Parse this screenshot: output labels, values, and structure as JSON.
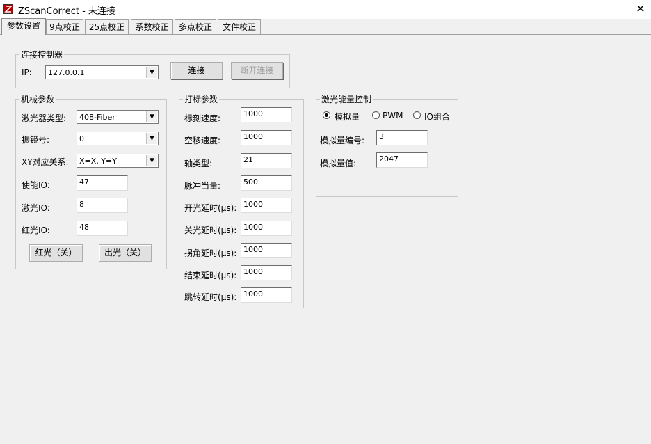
{
  "window": {
    "title": "ZScanCorrect - 未连接",
    "close_icon": "close-icon"
  },
  "tabs": [
    {
      "label": "参数设置"
    },
    {
      "label": "9点校正"
    },
    {
      "label": "25点校正"
    },
    {
      "label": "系数校正"
    },
    {
      "label": "多点校正"
    },
    {
      "label": "文件校正"
    }
  ],
  "connect": {
    "group_label": "连接控制器",
    "ip_label": "IP:",
    "ip_value": "127.0.0.1",
    "connect_button": "连接",
    "disconnect_button": "断开连接"
  },
  "mechanical": {
    "group_label": "机械参数",
    "laser_type_label": "激光器类型:",
    "laser_type_value": "408-Fiber",
    "galvo_label": "振镜号:",
    "galvo_value": "0",
    "xy_label": "XY对应关系:",
    "xy_value": "X=X, Y=Y",
    "enable_io_label": "使能IO:",
    "enable_io_value": "47",
    "laser_io_label": "激光IO:",
    "laser_io_value": "8",
    "red_io_label": "红光IO:",
    "red_io_value": "48",
    "red_light_button": "红光（关）",
    "laser_out_button": "出光（关）"
  },
  "marking": {
    "group_label": "打标参数",
    "fields": [
      {
        "label": "标刻速度:",
        "value": "1000"
      },
      {
        "label": "空移速度:",
        "value": "1000"
      },
      {
        "label": "轴类型:",
        "value": "21"
      },
      {
        "label": "脉冲当量:",
        "value": "500"
      },
      {
        "label": "开光延时(μs):",
        "value": "1000"
      },
      {
        "label": "关光延时(μs):",
        "value": "1000"
      },
      {
        "label": "拐角延时(μs):",
        "value": "1000"
      },
      {
        "label": "结束延时(μs):",
        "value": "1000"
      },
      {
        "label": "跳转延时(μs):",
        "value": "1000"
      }
    ]
  },
  "energy": {
    "group_label": "激光能量控制",
    "radio_analog": "模拟量",
    "radio_pwm": "PWM",
    "radio_io": "IO组合",
    "selected": "模拟量",
    "analog_no_label": "模拟量编号:",
    "analog_no_value": "3",
    "analog_val_label": "模拟量值:",
    "analog_val_value": "2047"
  }
}
